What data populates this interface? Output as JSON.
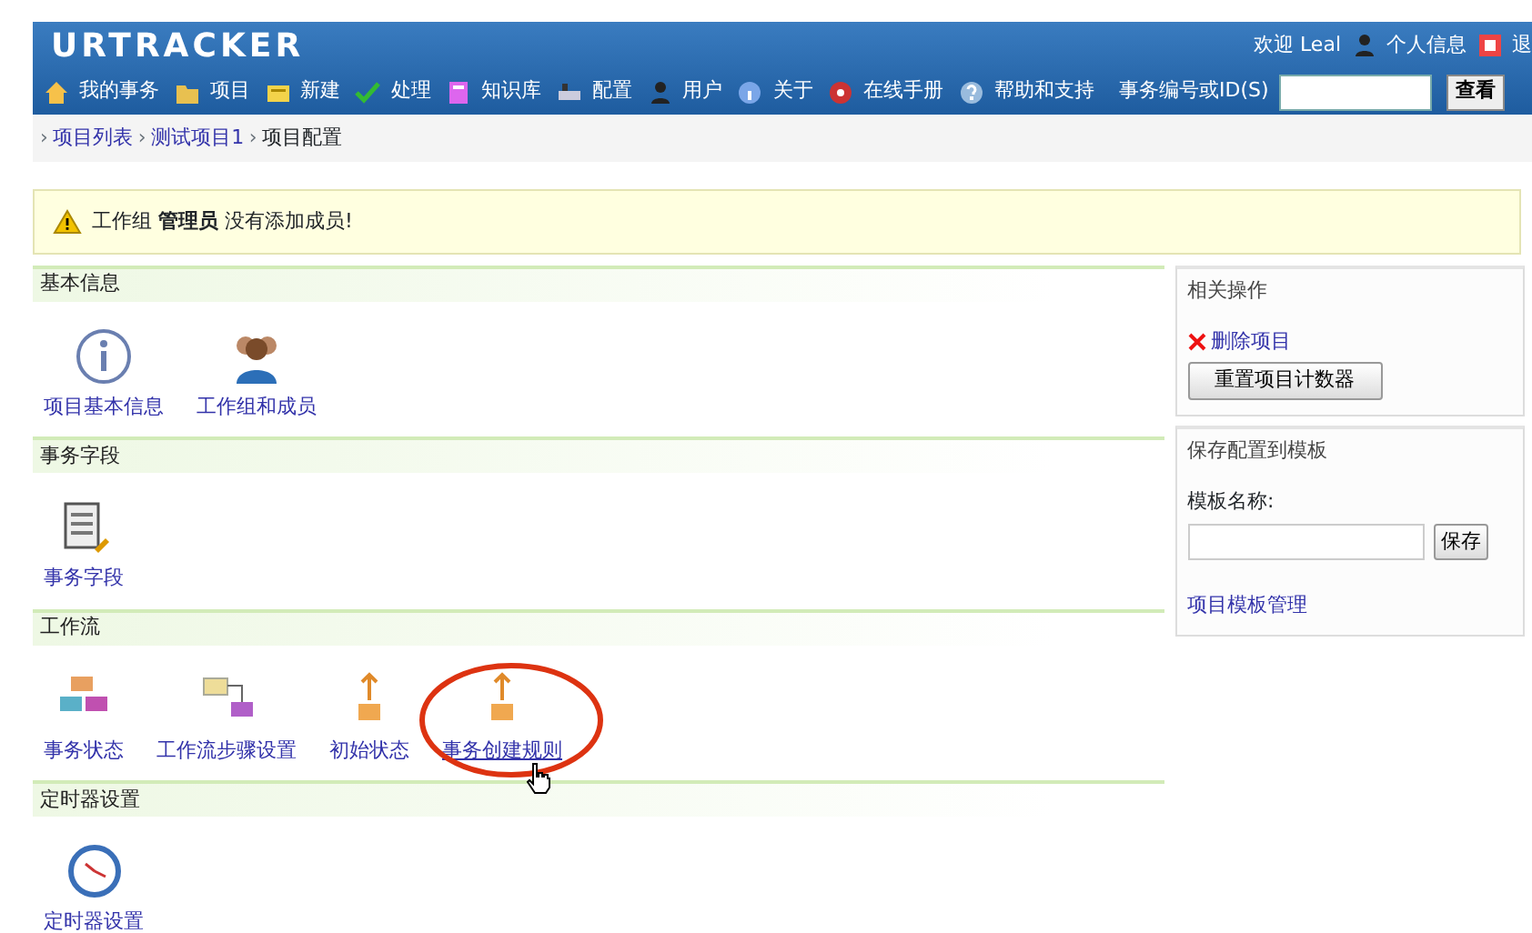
{
  "header": {
    "logo": "URTRACKER",
    "welcome": "欢迎 Leal",
    "user_links": [
      {
        "label": "个人信息",
        "kind": "user"
      },
      {
        "label": "退",
        "kind": "logout"
      }
    ]
  },
  "nav": [
    {
      "label": "我的事务",
      "kind": "home"
    },
    {
      "label": "项目",
      "kind": "folder"
    },
    {
      "label": "新建",
      "kind": "new"
    },
    {
      "label": "处理",
      "kind": "check"
    },
    {
      "label": "知识库",
      "kind": "book"
    },
    {
      "label": "配置",
      "kind": "config"
    },
    {
      "label": "用户",
      "kind": "user"
    },
    {
      "label": "关于",
      "kind": "about"
    },
    {
      "label": "在线手册",
      "kind": "manual"
    },
    {
      "label": "帮助和支持",
      "kind": "help"
    }
  ],
  "search": {
    "label": "事务编号或ID(S)",
    "button": "查看"
  },
  "breadcrumb": {
    "separator": "›",
    "items": [
      "项目列表",
      "测试项目1",
      "项目配置"
    ]
  },
  "alert": {
    "text": "工作组 **管理员** 没有添加成员!"
  },
  "sections": [
    {
      "title": "基本信息",
      "items": [
        {
          "label": "项目基本信息",
          "kind": "info",
          "hovered": false,
          "circled": false
        },
        {
          "label": "工作组和成员",
          "kind": "group",
          "hovered": false,
          "circled": false
        }
      ]
    },
    {
      "title": "事务字段",
      "items": [
        {
          "label": "事务字段",
          "kind": "form",
          "hovered": false,
          "circled": false
        }
      ]
    },
    {
      "title": "工作流",
      "items": [
        {
          "label": "事务状态",
          "kind": "states",
          "hovered": false,
          "circled": false
        },
        {
          "label": "工作流步骤设置",
          "kind": "steps",
          "hovered": false,
          "circled": false
        },
        {
          "label": "初始状态",
          "kind": "start",
          "hovered": false,
          "circled": false
        },
        {
          "label": "事务创建规则",
          "kind": "start",
          "hovered": true,
          "circled": true
        }
      ]
    },
    {
      "title": "定时器设置",
      "items": [
        {
          "label": "定时器设置",
          "kind": "clock",
          "hovered": false,
          "circled": false
        }
      ]
    }
  ],
  "side_panels": [
    {
      "title": "相关操作",
      "delete_link": "删除项目",
      "button": "重置项目计数器"
    },
    {
      "title": "保存配置到模板",
      "field_label": "模板名称:",
      "save_button": "保存",
      "link": "项目模板管理"
    }
  ]
}
